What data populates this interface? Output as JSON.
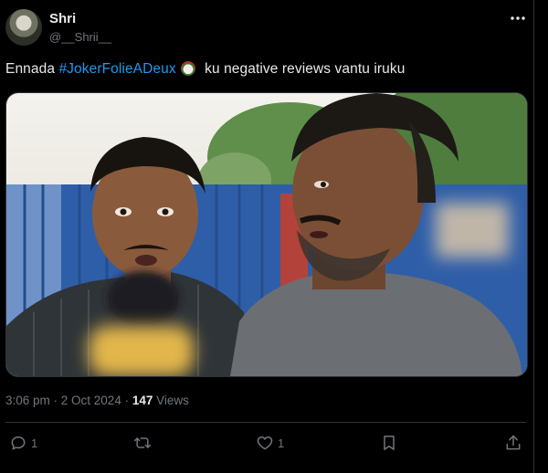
{
  "user": {
    "name": "Shri",
    "handle": "@__Shrii__"
  },
  "tweet": {
    "text_before": "Ennada ",
    "hashtag": "#JokerFolieADeux",
    "text_after": " ku negative reviews vantu iruku",
    "emoji": "joker-face-emoji"
  },
  "meta": {
    "time": "3:06 pm",
    "separator": " · ",
    "date": "2 Oct 2024",
    "views_count": "147",
    "views_label": " Views"
  },
  "actions": {
    "reply_count": "1",
    "like_count": "1"
  },
  "colors": {
    "accent": "#1d9bf0",
    "muted": "#71767b",
    "divider": "#2f3336"
  }
}
